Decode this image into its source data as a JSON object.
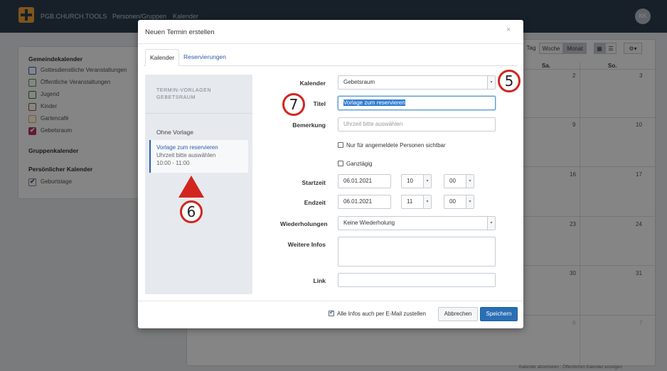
{
  "topnav": {
    "brand": "PGB.CHURCH.TOOLS",
    "links": [
      "Personen/Gruppen",
      "Kalender"
    ],
    "avatar_initials": "KK"
  },
  "sidebar": {
    "heading_gemeinde": "Gemeindekalender",
    "calendars": [
      {
        "label": "Gottesdienstliche Veranstaltungen",
        "color": "#2a5ea8",
        "checked": false
      },
      {
        "label": "Öffentliche Veranstaltungen",
        "color": "#4a9a49",
        "checked": false
      },
      {
        "label": "Jugend",
        "color": "#3a7a2a",
        "checked": false
      },
      {
        "label": "Kinder",
        "color": "#8a5a2a",
        "checked": false
      },
      {
        "label": "Gartencafé",
        "color": "#e8b030",
        "checked": false
      },
      {
        "label": "Gebetsraum",
        "color": "#b8346b",
        "checked": true
      }
    ],
    "heading_gruppen": "Gruppenkalender",
    "heading_persoenlich": "Persönlicher Kalender",
    "personal": [
      {
        "label": "Geburtstage",
        "checked": true
      }
    ]
  },
  "calendar_view": {
    "view_buttons": [
      "Tag",
      "Woche",
      "Monat"
    ],
    "active_view": "Monat",
    "day_headers": [
      "Sa.",
      "So."
    ],
    "week_rows": [
      [
        "2",
        "3"
      ],
      [
        "9",
        "10"
      ],
      [
        "16",
        "17"
      ],
      [
        "23",
        "24"
      ],
      [
        "30",
        "31"
      ],
      [
        "6",
        "7"
      ]
    ],
    "footer": "Kalender abonnieren · Öffentlichen Kalender anzeigen"
  },
  "modal": {
    "title": "Neuen Termin erstellen",
    "close": "×",
    "tabs": [
      "Kalender",
      "Reservierungen"
    ],
    "templates": {
      "heading": "TERMIN-VORLAGEN GEBETSRAUM",
      "none": "Ohne Vorlage",
      "selected_title": "Vorlage zum reservieren",
      "selected_sub": "Uhrzeit bitte auswählen",
      "selected_time": "10:00 - 11:00"
    },
    "form": {
      "kalender_label": "Kalender",
      "kalender_value": "Gebetsraum",
      "titel_label": "Titel",
      "titel_value": "Vorlage zum reservieren",
      "bemerkung_label": "Bemerkung",
      "bemerkung_placeholder": "Uhrzeit bitte auswählen",
      "only_logged_in": "Nur für angemeldete Personen sichtbar",
      "ganztaegig": "Ganztägig",
      "startzeit_label": "Startzeit",
      "start_date": "06.01.2021",
      "start_hour": "10",
      "start_min": "00",
      "endzeit_label": "Endzeit",
      "end_date": "06.01.2021",
      "end_hour": "11",
      "end_min": "00",
      "wiederholungen_label": "Wiederholungen",
      "wiederholungen_value": "Keine Wiederholung",
      "weitere_infos_label": "Weitere Infos",
      "link_label": "Link"
    },
    "footer": {
      "email_checkbox": "Alle Infos auch per E-Mail zustellen",
      "cancel": "Abbrechen",
      "save": "Speichern"
    }
  },
  "annotations": {
    "badge_5": "5",
    "badge_6": "6",
    "badge_7": "7",
    "color": "#d1261f"
  }
}
